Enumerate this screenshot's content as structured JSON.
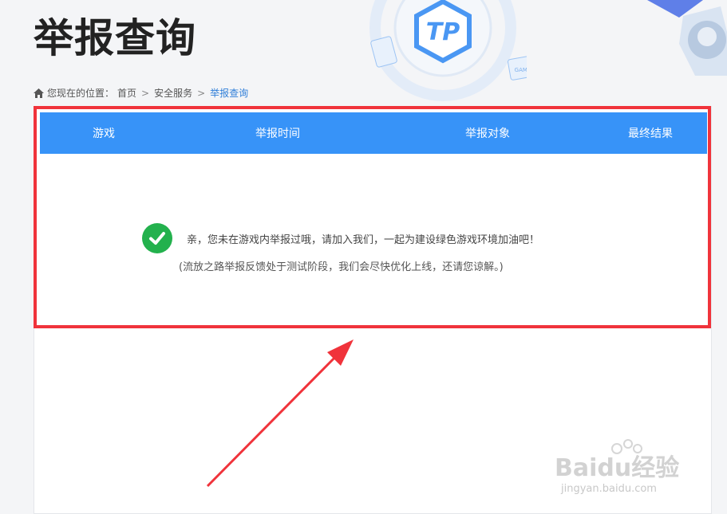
{
  "page": {
    "title": "举报查询"
  },
  "breadcrumb": {
    "prefix": "您现在的位置：",
    "home": "首页",
    "sep": ">",
    "section": "安全服务",
    "current": "举报查询"
  },
  "table": {
    "columns": [
      "游戏",
      "举报时间",
      "举报对象",
      "最终结果"
    ]
  },
  "empty_state": {
    "message": "亲，您未在游戏内举报过哦，请加入我们，一起为建设绿色游戏环境加油吧！",
    "note": "(流放之路举报反馈处于测试阶段，我们会尽快优化上线，还请您谅解。)"
  },
  "decor": {
    "logo_text": "TP",
    "game_badge": "GAME"
  },
  "watermark": {
    "brand": "Baidu经验",
    "url": "jingyan.baidu.com"
  },
  "colors": {
    "header_blue": "#3793f8",
    "highlight_red": "#f0333b",
    "check_green": "#23b14d",
    "link_blue": "#2f7ed8"
  }
}
